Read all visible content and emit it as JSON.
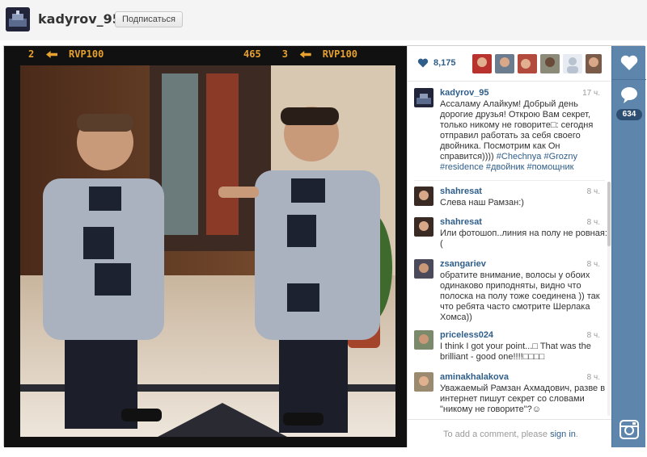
{
  "header": {
    "username": "kadyrov_95",
    "follow_label": "Подписаться"
  },
  "photo": {
    "film_left": {
      "number": "2",
      "label": "RVP100"
    },
    "film_right": {
      "number_a": "465",
      "number_b": "3",
      "label": "RVP100"
    }
  },
  "likes": {
    "count": "8,175"
  },
  "caption": {
    "username": "kadyrov_95",
    "time": "17 ч.",
    "text": "Ассаламу Алайкум! Добрый день дорогие друзья! Открою Вам секрет, только никому не говорите□: сегодня отправил работать за себя своего двойника. Посмотрим как Он справится)))) ",
    "hashtags": "#Chechnya #Grozny #residence #двойник #помощник"
  },
  "comments": [
    {
      "username": "shahresat",
      "time": "8 ч.",
      "text": "Слева наш Рамзан:)"
    },
    {
      "username": "shahresat",
      "time": "8 ч.",
      "text": "Или фотошоп..линия на полу не ровная:("
    },
    {
      "username": "zsangariev",
      "time": "8 ч.",
      "text": "обратите внимание, волосы у обоих одинаково приподняты, видно что полоска на полу тоже соединена )) так что ребята часто смотрите Шерлака Хомса))"
    },
    {
      "username": "priceless024",
      "time": "8 ч.",
      "text": "I think I got your point...□ That was the brilliant - good one!!!!□□□□"
    },
    {
      "username": "aminakhalakova",
      "time": "8 ч.",
      "text": "Уважаемый Рамзан Ахмадович, разве в интернет пишут секрет со словами \"никому не говорите\"?☺"
    }
  ],
  "add_comment": {
    "prompt": "To add a comment, please ",
    "signin": "sign in",
    "end": "."
  },
  "rail": {
    "comment_count": "634"
  },
  "colors": {
    "link_blue": "#2f5e8a",
    "rail_blue": "#5e86ad",
    "film_orange": "#e6a12e"
  }
}
